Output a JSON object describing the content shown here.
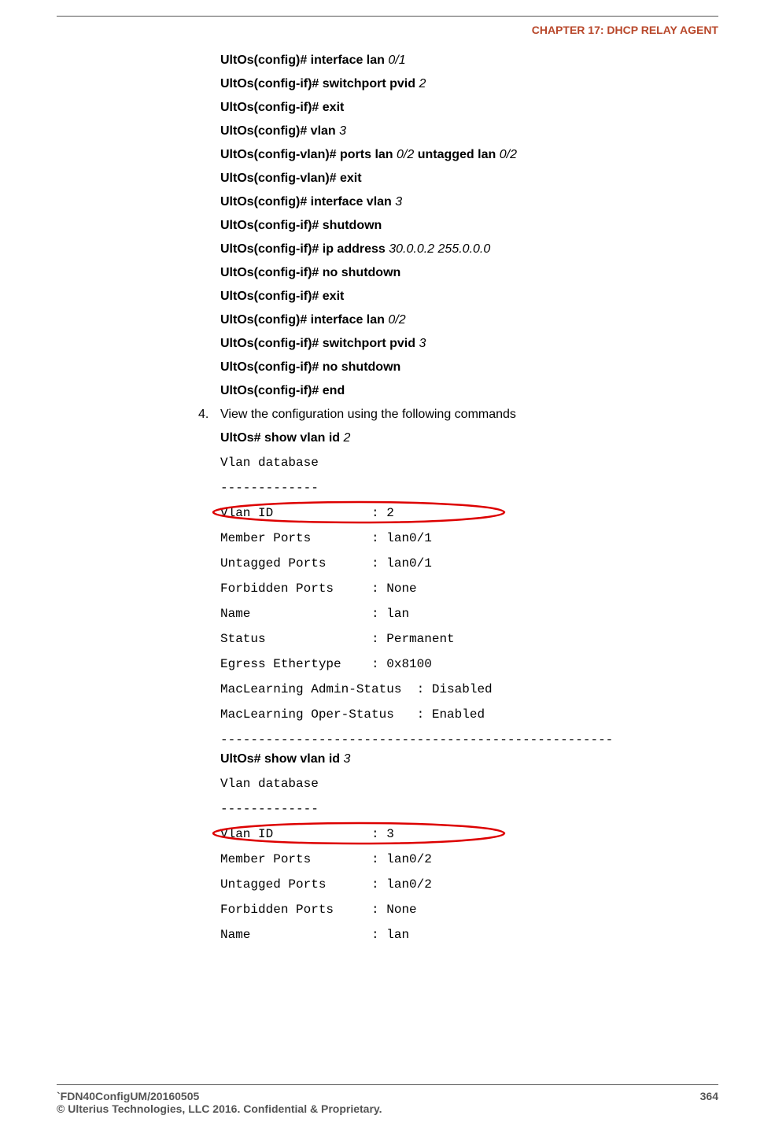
{
  "header": {
    "chapter": "CHAPTER 17: DHCP RELAY AGENT"
  },
  "config_lines": [
    {
      "prefix": "UltOs(config)# interface lan ",
      "arg": "0/1"
    },
    {
      "prefix": "UltOs(config-if)# switchport pvid ",
      "arg": "2"
    },
    {
      "prefix": "UltOs(config-if)# exit",
      "arg": ""
    },
    {
      "prefix": "UltOs(config)# vlan ",
      "arg": "3"
    },
    {
      "prefix": "UltOs(config-vlan)# ports lan ",
      "arg": "0/2",
      "suffix": " untagged lan ",
      "arg2": "0/2"
    },
    {
      "prefix": "UltOs(config-vlan)# exit",
      "arg": ""
    },
    {
      "prefix": "UltOs(config)# interface vlan ",
      "arg": "3"
    },
    {
      "prefix": "UltOs(config-if)# shutdown",
      "arg": ""
    },
    {
      "prefix": "UltOs(config-if)# ip address ",
      "arg": "30.0.0.2 255.0.0.0"
    },
    {
      "prefix": "UltOs(config-if)# no shutdown",
      "arg": ""
    },
    {
      "prefix": "UltOs(config-if)# exit",
      "arg": ""
    },
    {
      "prefix": "UltOs(config)# interface lan ",
      "arg": "0/2"
    },
    {
      "prefix": "UltOs(config-if)# switchport pvid ",
      "arg": "3"
    },
    {
      "prefix": "UltOs(config-if)# no shutdown",
      "arg": ""
    },
    {
      "prefix": "UltOs(config-if)# end",
      "arg": ""
    }
  ],
  "step": {
    "num": "4.",
    "text": "View the configuration using the following commands"
  },
  "show1": {
    "prefix": "UltOs# show vlan id ",
    "arg": "2"
  },
  "out1": {
    "header": "Vlan database",
    "sep": "-------------",
    "vlan_id": "Vlan ID             : 2",
    "rest": "Member Ports        : lan0/1\nUntagged Ports      : lan0/1\nForbidden Ports     : None\nName                : lan\nStatus              : Permanent\nEgress Ethertype    : 0x8100\nMacLearning Admin-Status  : Disabled\nMacLearning Oper-Status   : Enabled\n----------------------------------------------------"
  },
  "show2": {
    "prefix": "UltOs# show vlan id ",
    "arg": "3"
  },
  "out2": {
    "header": "Vlan database",
    "sep": "-------------",
    "vlan_id": "Vlan ID             : 3",
    "rest": "Member Ports        : lan0/2\nUntagged Ports      : lan0/2\nForbidden Ports     : None\nName                : lan"
  },
  "footer": {
    "doc_id": "`FDN40ConfigUM/20160505",
    "page": "364",
    "copyright": "© Ulterius Technologies, LLC 2016. Confidential & Proprietary."
  }
}
